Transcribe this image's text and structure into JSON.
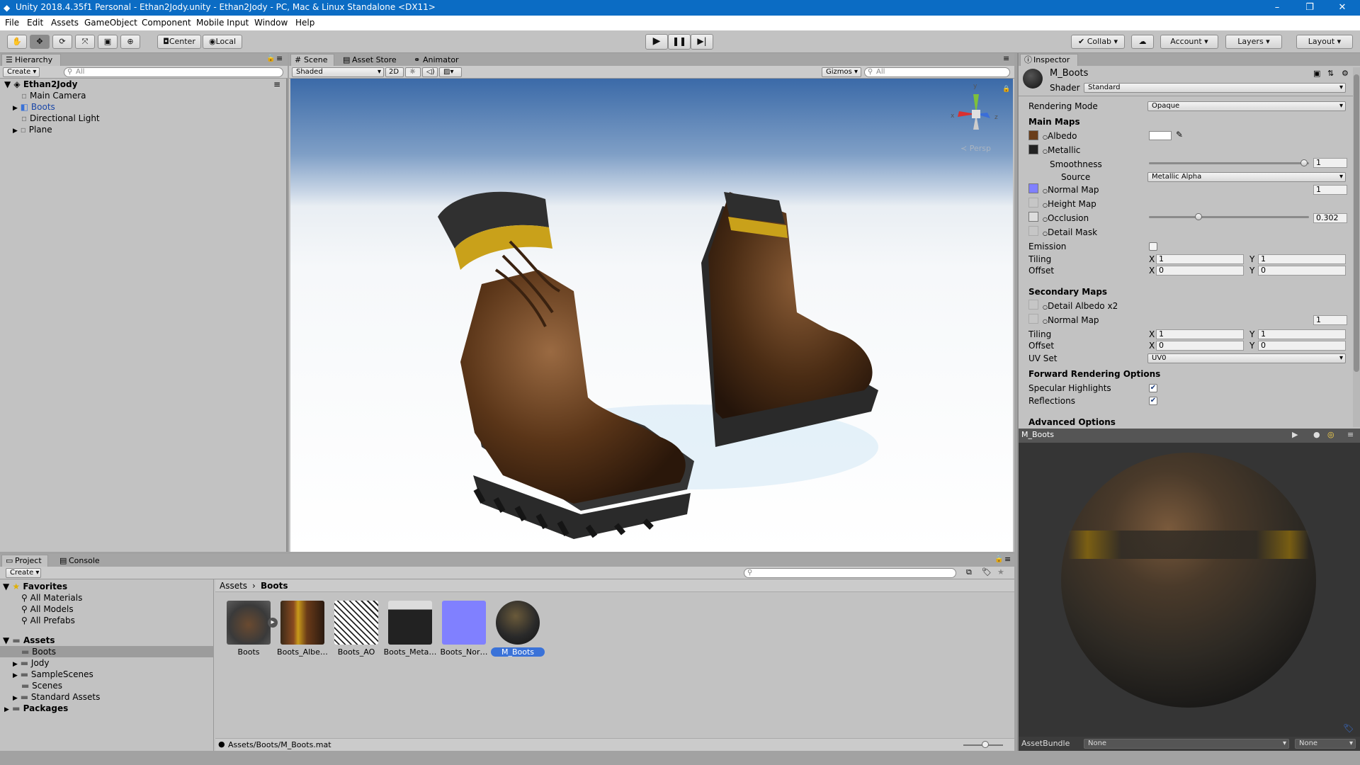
{
  "window": {
    "title": "Unity 2018.4.35f1 Personal - Ethan2Jody.unity - Ethan2Jody - PC, Mac & Linux Standalone <DX11>",
    "minimize": "–",
    "maximize": "❐",
    "close": "✕"
  },
  "menu": [
    "File",
    "Edit",
    "Assets",
    "GameObject",
    "Component",
    "Mobile Input",
    "Window",
    "Help"
  ],
  "toolbar": {
    "pivot": "Center",
    "space": "Local",
    "collab": "Collab",
    "account": "Account",
    "layers": "Layers",
    "layout": "Layout"
  },
  "hierarchy": {
    "tab": "Hierarchy",
    "create": "Create",
    "search_placeholder": "All",
    "scene": "Ethan2Jody",
    "items": [
      "Main Camera",
      "Boots",
      "Directional Light",
      "Plane"
    ]
  },
  "scene": {
    "tabs": [
      "Scene",
      "Asset Store",
      "Animator"
    ],
    "shading": "Shaded",
    "mode2d": "2D",
    "gizmos": "Gizmos",
    "search_placeholder": "All",
    "persp": "Persp",
    "axis_x": "x",
    "axis_y": "y",
    "axis_z": "z"
  },
  "inspector": {
    "tab": "Inspector",
    "material_name": "M_Boots",
    "shader_label": "Shader",
    "shader_value": "Standard",
    "rendering_mode_label": "Rendering Mode",
    "rendering_mode_value": "Opaque",
    "main_maps": "Main Maps",
    "albedo": "Albedo",
    "metallic": "Metallic",
    "smoothness": "Smoothness",
    "smoothness_value": "1",
    "source": "Source",
    "source_value": "Metallic Alpha",
    "normal_map": "Normal Map",
    "normal_value": "1",
    "height_map": "Height Map",
    "occlusion": "Occlusion",
    "occlusion_value": "0.302",
    "detail_mask": "Detail Mask",
    "emission": "Emission",
    "tiling": "Tiling",
    "offset": "Offset",
    "x": "X",
    "y": "Y",
    "tiling_x": "1",
    "tiling_y": "1",
    "offset_x": "0",
    "offset_y": "0",
    "secondary_maps": "Secondary Maps",
    "detail_albedo": "Detail Albedo x2",
    "sec_normal_map": "Normal Map",
    "sec_normal_value": "1",
    "sec_tiling_x": "1",
    "sec_tiling_y": "1",
    "sec_offset_x": "0",
    "sec_offset_y": "0",
    "uv_set": "UV Set",
    "uv_set_value": "UV0",
    "forward_options": "Forward Rendering Options",
    "specular_highlights": "Specular Highlights",
    "reflections": "Reflections",
    "advanced_options": "Advanced Options",
    "preview_title": "M_Boots",
    "assetbundle_label": "AssetBundle",
    "assetbundle_value": "None",
    "assetbundle_variant": "None",
    "smoothness_level": 0.99,
    "occlusion_level": 0.302
  },
  "project": {
    "tabs": [
      "Project",
      "Console"
    ],
    "create": "Create",
    "favorites_title": "Favorites",
    "favorites": [
      "All Materials",
      "All Models",
      "All Prefabs"
    ],
    "assets_title": "Assets",
    "asset_folders": [
      "Boots",
      "Jody",
      "SampleScenes",
      "Scenes",
      "Standard Assets"
    ],
    "packages_title": "Packages",
    "breadcrumb_root": "Assets",
    "breadcrumb_sep": "›",
    "breadcrumb_current": "Boots",
    "files": [
      "Boots",
      "Boots_Albe…",
      "Boots_AO",
      "Boots_Meta…",
      "Boots_Nor…",
      "M_Boots"
    ],
    "status_path": "Assets/Boots/M_Boots.mat"
  },
  "colors": {
    "accent": "#3a72d8",
    "titlebar": "#0b6cc4",
    "normal_map": "#8080ff"
  }
}
